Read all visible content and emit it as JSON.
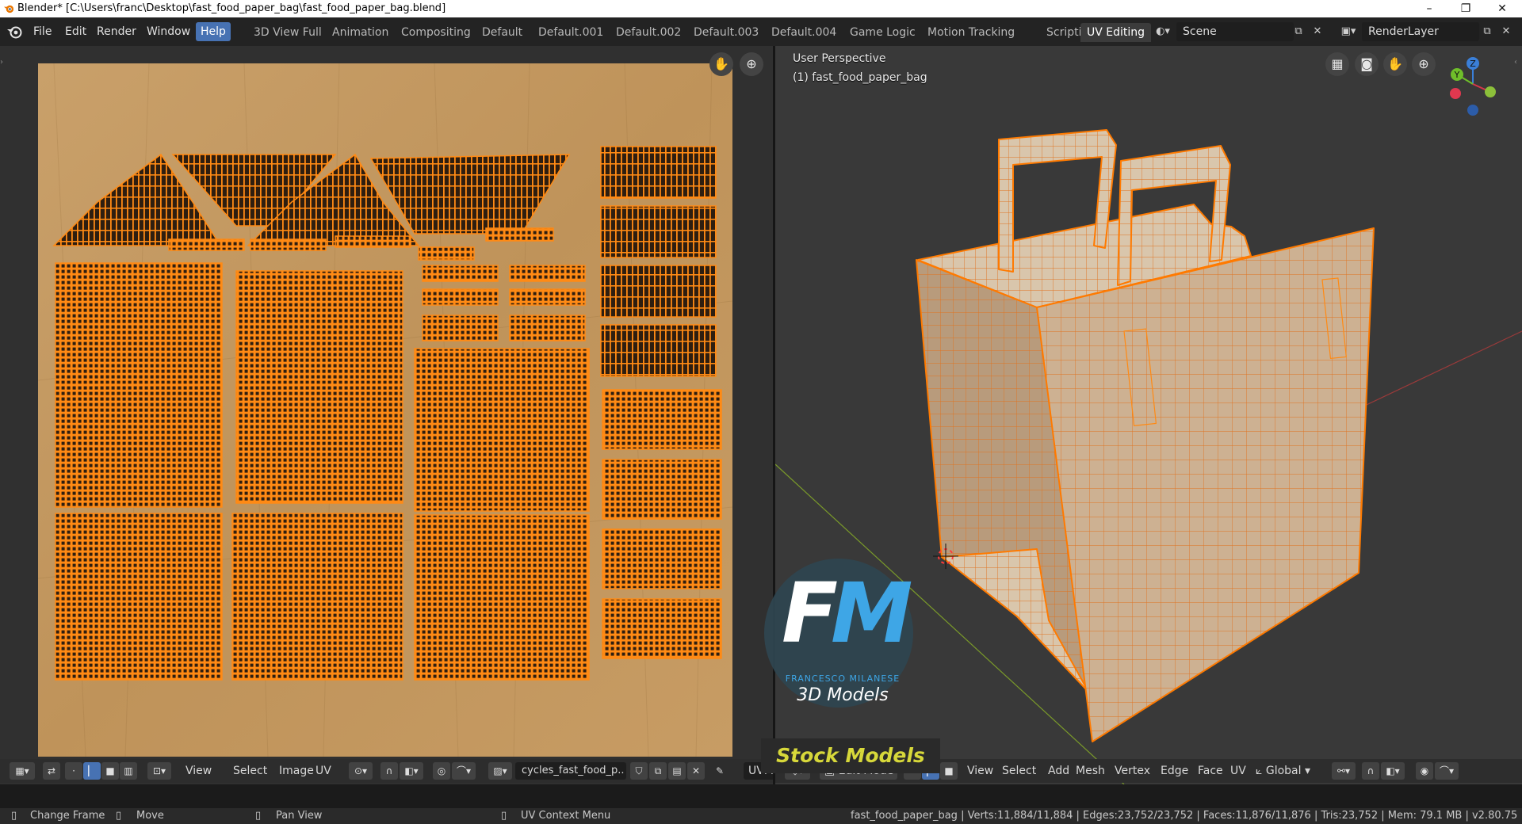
{
  "window": {
    "title": "Blender* [C:\\Users\\franc\\Desktop\\fast_food_paper_bag\\fast_food_paper_bag.blend]",
    "minimize": "–",
    "maximize": "❐",
    "close": "✕"
  },
  "menu": [
    "File",
    "Edit",
    "Render",
    "Window",
    "Help"
  ],
  "active_menu": "Help",
  "workspaces": [
    "3D View Full",
    "Animation",
    "Compositing",
    "Default",
    "Default.001",
    "Default.002",
    "Default.003",
    "Default.004",
    "Game Logic",
    "Motion Tracking",
    "Scripting",
    "UV Editing"
  ],
  "active_workspace": "UV Editing",
  "scene": {
    "value": "Scene"
  },
  "render_layer": {
    "value": "RenderLayer"
  },
  "uv_editor": {
    "header": {
      "menus": [
        "View",
        "Select",
        "Image",
        "UV"
      ],
      "image_name": "cycles_fast_food_p..",
      "uv_map": "UVM"
    }
  },
  "viewport": {
    "perspective": "User Perspective",
    "object": "(1) fast_food_paper_bag",
    "gizmo": {
      "z": "Z",
      "y": "Y",
      "x": "X"
    },
    "header": {
      "mode": "Edit Mode",
      "menus": [
        "View",
        "Select",
        "Add",
        "Mesh",
        "Vertex",
        "Edge",
        "Face",
        "UV"
      ],
      "orientation": "Global"
    }
  },
  "watermark": {
    "initials_f": "F",
    "initials_m": "M",
    "name": "FRANCESCO MILANESE",
    "subtitle": "3D Models",
    "banner": "Stock Models",
    "accent": "#3ea6e6",
    "banner_color": "#d7d83a"
  },
  "statusbar": {
    "hints": [
      {
        "icon": "mouse-left-icon",
        "label": "Change Frame"
      },
      {
        "icon": "mouse-drag-icon",
        "label": "Move"
      },
      {
        "icon": "mouse-middle-icon",
        "label": "Pan View"
      },
      {
        "icon": "mouse-right-icon",
        "label": "UV Context Menu"
      }
    ],
    "stats": "fast_food_paper_bag | Verts:11,884/11,884 | Edges:23,752/23,752 | Faces:11,876/11,876 | Tris:23,752 | Mem: 79.1 MB | v2.80.75"
  },
  "colors": {
    "accent": "#4772b3",
    "selection": "#ff7a00",
    "paper": "#c59a5e"
  }
}
